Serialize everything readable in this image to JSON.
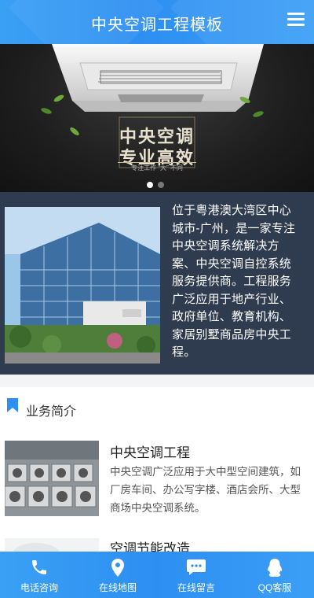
{
  "header": {
    "title": "中央空调工程模板",
    "menu_icon": "hamburger-menu-icon"
  },
  "banner": {
    "slogan_line1": "中央空调",
    "slogan_line2": "专业高效",
    "slogan_sub": "专注工作 “大” 不同",
    "slide_count": 2,
    "active_slide": 1
  },
  "intro": {
    "text": "位于粤港澳大湾区中心城市-广州，是一家专注中央空调系统解决方案、中央空调自控系统服务提供商。工程服务广泛应用于地产行业、政府单位、教育机构、家居别墅商品房中央工程。"
  },
  "section": {
    "title": "业务简介",
    "icon": "bookmark-icon"
  },
  "items": [
    {
      "name": "中央空调工程",
      "desc": "中央空调广泛应用于大中型空间建筑，如厂房车间、办公写字楼、酒店会所、大型商场中央空调系统。"
    },
    {
      "name": "空调节能改造",
      "desc": ""
    }
  ],
  "bottom_nav": [
    {
      "label": "电话咨询",
      "icon": "phone-icon"
    },
    {
      "label": "在线地图",
      "icon": "map-pin-icon"
    },
    {
      "label": "在线留言",
      "icon": "message-icon"
    },
    {
      "label": "QQ客服",
      "icon": "qq-penguin-icon"
    }
  ],
  "colors": {
    "primary": "#2d8ff2",
    "intro_bg": "#2f3b4f",
    "banner_bg": "#1e1e1e"
  }
}
